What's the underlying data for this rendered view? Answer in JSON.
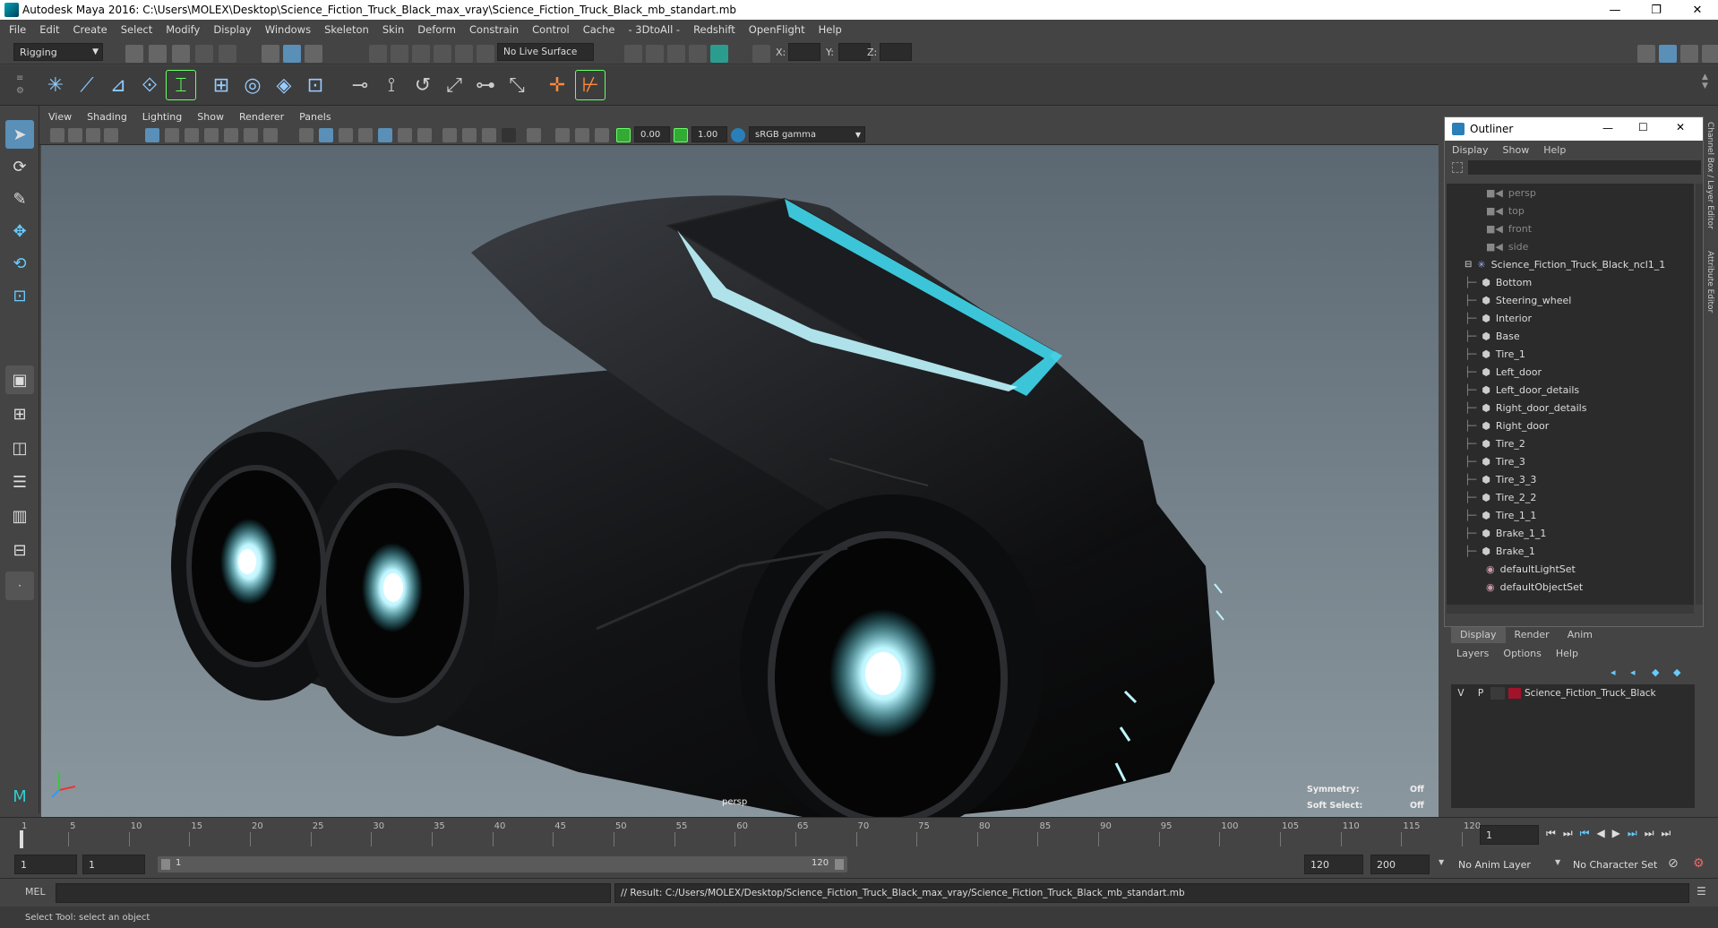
{
  "window": {
    "title": "Autodesk Maya 2016: C:\\Users\\MOLEX\\Desktop\\Science_Fiction_Truck_Black_max_vray\\Science_Fiction_Truck_Black_mb_standart.mb",
    "minimize": "—",
    "maximize": "❐",
    "close": "✕"
  },
  "menus": [
    "File",
    "Edit",
    "Create",
    "Select",
    "Modify",
    "Display",
    "Windows",
    "Skeleton",
    "Skin",
    "Deform",
    "Constrain",
    "Control",
    "Cache",
    "- 3DtoAll -",
    "Redshift",
    "OpenFlight",
    "Help"
  ],
  "status": {
    "mode": "Rigging",
    "live_surface": "No Live Surface",
    "x_label": "X:",
    "y_label": "Y:",
    "z_label": "Z:"
  },
  "panel": {
    "menus": [
      "View",
      "Shading",
      "Lighting",
      "Show",
      "Renderer",
      "Panels"
    ],
    "exposure": "0.00",
    "gamma": "1.00",
    "colorspace": "sRGB gamma"
  },
  "viewport": {
    "camera": "persp",
    "symmetry_label": "Symmetry:",
    "symmetry_value": "Off",
    "soft_select_label": "Soft Select:",
    "soft_select_value": "Off"
  },
  "outliner": {
    "title": "Outliner",
    "menus": [
      "Display",
      "Show",
      "Help"
    ],
    "cameras": [
      "persp",
      "top",
      "front",
      "side"
    ],
    "root": "Science_Fiction_Truck_Black_ncl1_1",
    "children": [
      "Bottom",
      "Steering_wheel",
      "Interior",
      "Base",
      "Tire_1",
      "Left_door",
      "Left_door_details",
      "Right_door_details",
      "Right_door",
      "Tire_2",
      "Tire_3",
      "Tire_3_3",
      "Tire_2_2",
      "Tire_1_1",
      "Brake_1_1",
      "Brake_1"
    ],
    "sets": [
      "defaultLightSet",
      "defaultObjectSet"
    ]
  },
  "layers": {
    "tabs": [
      "Display",
      "Render",
      "Anim"
    ],
    "menus": [
      "Layers",
      "Options",
      "Help"
    ],
    "row": {
      "v": "V",
      "p": "P",
      "name": "Science_Fiction_Truck_Black",
      "color": "#a0132b"
    }
  },
  "timeline": {
    "ticks": [
      "5",
      "10",
      "15",
      "20",
      "25",
      "30",
      "35",
      "40",
      "45",
      "50",
      "55",
      "60",
      "65",
      "70",
      "75",
      "80",
      "85",
      "90",
      "95",
      "100",
      "105",
      "110",
      "115",
      "120"
    ],
    "start_tick": "1",
    "current_frame": "1"
  },
  "range": {
    "start": "1",
    "playback_start": "1",
    "slider_start": "1",
    "slider_end": "120",
    "playback_end": "120",
    "end": "200",
    "anim_layer": "No Anim Layer",
    "character_set": "No Character Set"
  },
  "command": {
    "label": "MEL",
    "result": "// Result: C:/Users/MOLEX/Desktop/Science_Fiction_Truck_Black_max_vray/Science_Fiction_Truck_Black_mb_standart.mb"
  },
  "help": "Select Tool: select an object",
  "side_tabs": [
    "Channel Box / Layer Editor",
    "Attribute Editor"
  ],
  "accent": "#40d8ec"
}
